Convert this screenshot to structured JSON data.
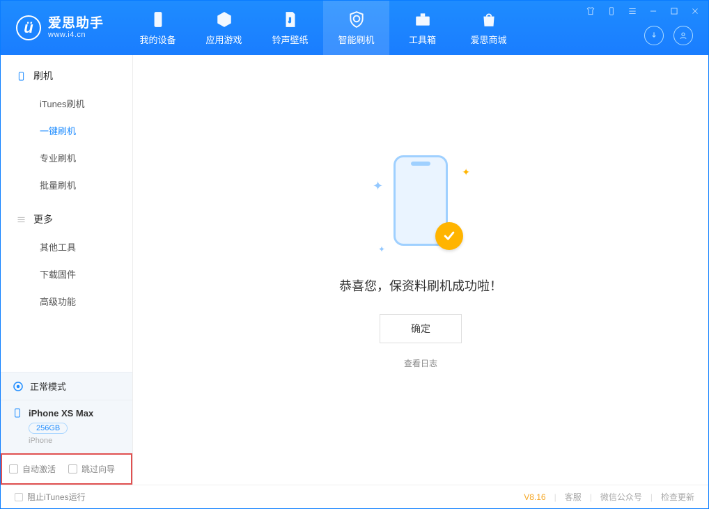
{
  "app": {
    "title": "爱思助手",
    "subtitle": "www.i4.cn"
  },
  "topTabs": [
    {
      "label": "我的设备"
    },
    {
      "label": "应用游戏"
    },
    {
      "label": "铃声壁纸"
    },
    {
      "label": "智能刷机"
    },
    {
      "label": "工具箱"
    },
    {
      "label": "爱思商城"
    }
  ],
  "sidebar": {
    "section1": {
      "title": "刷机",
      "items": [
        {
          "label": "iTunes刷机"
        },
        {
          "label": "一键刷机"
        },
        {
          "label": "专业刷机"
        },
        {
          "label": "批量刷机"
        }
      ]
    },
    "section2": {
      "title": "更多",
      "items": [
        {
          "label": "其他工具"
        },
        {
          "label": "下载固件"
        },
        {
          "label": "高级功能"
        }
      ]
    },
    "mode": "正常模式",
    "device": {
      "name": "iPhone XS Max",
      "storage": "256GB",
      "type": "iPhone"
    },
    "options": {
      "autoActivate": "自动激活",
      "skipSetup": "跳过向导"
    }
  },
  "main": {
    "successMessage": "恭喜您，保资料刷机成功啦！",
    "okButton": "确定",
    "viewLog": "查看日志"
  },
  "footer": {
    "blockItunes": "阻止iTunes运行",
    "version": "V8.16",
    "service": "客服",
    "wechat": "微信公众号",
    "checkUpdate": "检查更新"
  }
}
